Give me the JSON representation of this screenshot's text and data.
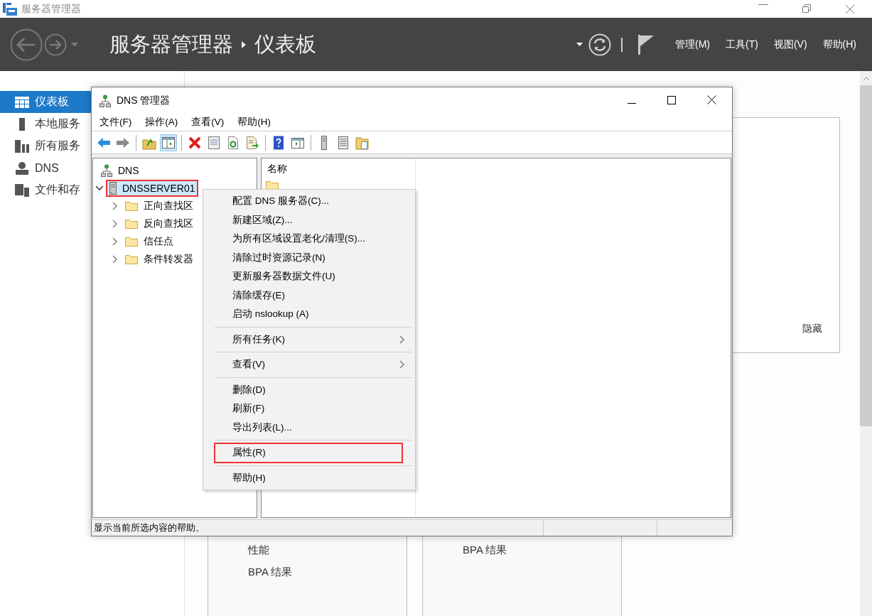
{
  "window": {
    "title": "服务器管理器"
  },
  "header": {
    "breadcrumb": [
      "服务器管理器",
      "仪表板"
    ],
    "menus": [
      "管理(M)",
      "工具(T)",
      "视图(V)",
      "帮助(H)"
    ]
  },
  "sidebar": {
    "items": [
      {
        "label": "仪表板",
        "kind": "dashboard",
        "selected": true
      },
      {
        "label": "本地服务",
        "kind": "server",
        "selected": false
      },
      {
        "label": "所有服务",
        "kind": "servers",
        "selected": false
      },
      {
        "label": "DNS",
        "kind": "dns",
        "selected": false
      },
      {
        "label": "文件和存",
        "kind": "files",
        "selected": false
      }
    ]
  },
  "dashboard": {
    "panel_link": "隐藏",
    "tiles": [
      {
        "items": [
          "性能",
          "BPA 结果"
        ]
      },
      {
        "items": [
          "BPA 结果"
        ]
      }
    ]
  },
  "dns_window": {
    "title": "DNS 管理器",
    "menus": [
      "文件(F)",
      "操作(A)",
      "查看(V)",
      "帮助(H)"
    ],
    "toolbar": [
      {
        "kind": "back",
        "pressed": false
      },
      {
        "kind": "forward",
        "pressed": false
      },
      {
        "kind": "separator"
      },
      {
        "kind": "up",
        "pressed": false
      },
      {
        "kind": "console",
        "pressed": true
      },
      {
        "kind": "separator"
      },
      {
        "kind": "delete",
        "pressed": false
      },
      {
        "kind": "properties",
        "pressed": false
      },
      {
        "kind": "refresh",
        "pressed": false
      },
      {
        "kind": "export",
        "pressed": false
      },
      {
        "kind": "separator"
      },
      {
        "kind": "help",
        "pressed": false
      },
      {
        "kind": "actionpane",
        "pressed": false
      },
      {
        "kind": "separator"
      },
      {
        "kind": "server",
        "pressed": false
      },
      {
        "kind": "list",
        "pressed": false
      },
      {
        "kind": "folderdoc",
        "pressed": false
      }
    ],
    "tree": [
      {
        "label": "DNS",
        "kind": "dns",
        "selected": false,
        "annotated": false,
        "children": [
          {
            "label": "DNSSERVER01",
            "kind": "server",
            "expanded": true,
            "selected": true,
            "annotated": true,
            "children": [
              {
                "label": "正向查找区",
                "kind": "folder",
                "expanded": false,
                "selected": false,
                "annotated": false
              },
              {
                "label": "反向查找区",
                "kind": "folder",
                "expanded": false,
                "selected": false,
                "annotated": false
              },
              {
                "label": "信任点",
                "kind": "folder",
                "expanded": false,
                "selected": false,
                "annotated": false
              },
              {
                "label": "条件转发器",
                "kind": "folder",
                "expanded": false,
                "selected": false,
                "annotated": false
              }
            ]
          }
        ]
      }
    ],
    "list": {
      "columns": [
        "名称"
      ]
    },
    "status_bar": "显示当前所选内容的帮助。"
  },
  "context_menu": {
    "items": [
      {
        "kind": "item",
        "label": "配置 DNS 服务器(C)...",
        "annotated": false
      },
      {
        "kind": "item",
        "label": "新建区域(Z)...",
        "annotated": false
      },
      {
        "kind": "item",
        "label": "为所有区域设置老化/清理(S)...",
        "annotated": false
      },
      {
        "kind": "item",
        "label": "清除过时资源记录(N)",
        "annotated": false
      },
      {
        "kind": "item",
        "label": "更新服务器数据文件(U)",
        "annotated": false
      },
      {
        "kind": "item",
        "label": "清除缓存(E)",
        "annotated": false
      },
      {
        "kind": "item",
        "label": "启动 nslookup (A)",
        "annotated": false
      },
      {
        "kind": "separator"
      },
      {
        "kind": "submenu",
        "label": "所有任务(K)",
        "annotated": false
      },
      {
        "kind": "separator"
      },
      {
        "kind": "submenu",
        "label": "查看(V)",
        "annotated": false
      },
      {
        "kind": "separator"
      },
      {
        "kind": "item",
        "label": "删除(D)",
        "annotated": false
      },
      {
        "kind": "item",
        "label": "刷新(F)",
        "annotated": false
      },
      {
        "kind": "item",
        "label": "导出列表(L)...",
        "annotated": false
      },
      {
        "kind": "separator"
      },
      {
        "kind": "item",
        "label": "属性(R)",
        "annotated": true
      },
      {
        "kind": "separator"
      },
      {
        "kind": "item",
        "label": "帮助(H)",
        "annotated": false
      }
    ]
  }
}
